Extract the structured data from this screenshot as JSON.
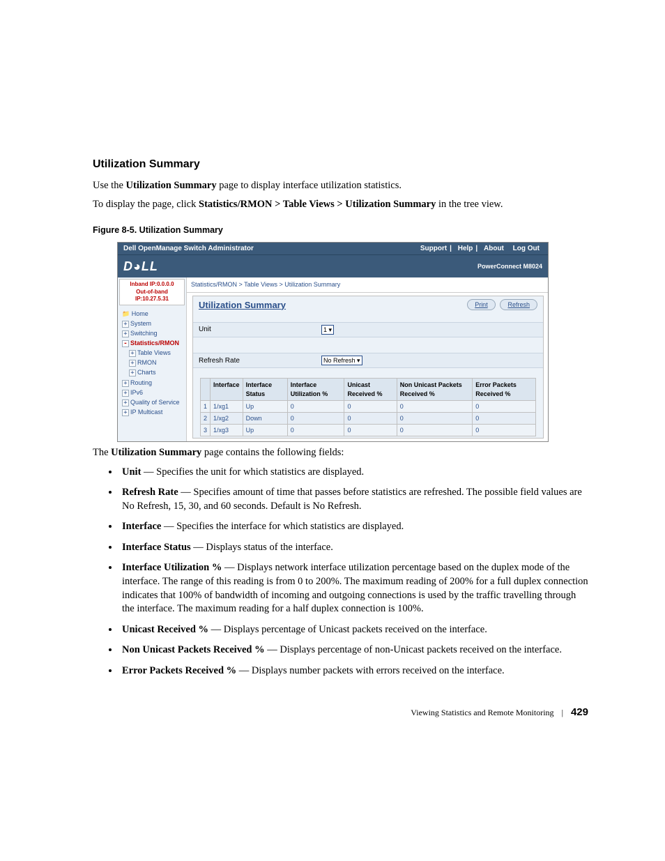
{
  "doc": {
    "heading": "Utilization Summary",
    "intro_pre": "Use the ",
    "intro_bold": "Utilization Summary",
    "intro_post": " page to display interface utilization statistics.",
    "howto_pre": "To display the page, click ",
    "howto_bold": "Statistics/RMON > Table Views > Utilization Summary",
    "howto_post": " in the tree view.",
    "fig_caption": "Figure 8-5.    Utilization Summary",
    "after_fig_pre": "The ",
    "after_fig_bold": "Utilization Summary",
    "after_fig_post": " page contains the following fields:"
  },
  "fields": {
    "f1_b": "Unit",
    "f1_t": " — Specifies the unit for which statistics are displayed.",
    "f2_b": "Refresh Rate",
    "f2_t": " — Specifies amount of time that passes before statistics are refreshed. The possible field values are No Refresh, 15, 30, and 60 seconds. Default is No Refresh.",
    "f3_b": "Interface",
    "f3_t": " — Specifies the interface for which statistics are displayed.",
    "f4_b": "Interface Status",
    "f4_t": " — Displays status of the interface.",
    "f5_b": "Interface Utilization %",
    "f5_t": " — Displays network interface utilization percentage based on the duplex mode of the interface. The range of this reading is from 0 to 200%. The maximum reading of 200% for a full duplex connection indicates that 100% of bandwidth of incoming and outgoing connections is used by the traffic travelling through the interface. The maximum reading for a half duplex connection is 100%.",
    "f6_b": "Unicast Received %",
    "f6_t": " — Displays percentage of Unicast packets received on the interface.",
    "f7_b": "Non Unicast Packets Received %",
    "f7_t": " — Displays percentage of non-Unicast packets received on the interface.",
    "f8_b": "Error Packets Received %",
    "f8_t": " — Displays number packets with errors received on the interface."
  },
  "footer": {
    "chapter": "Viewing Statistics and Remote Monitoring",
    "page": "429"
  },
  "ss": {
    "titlebar": "Dell OpenManage Switch Administrator",
    "links": {
      "support": "Support",
      "help": "Help",
      "about": "About",
      "logout": "Log Out"
    },
    "logo": "D◕LL",
    "product": "PowerConnect M8024",
    "ip": {
      "inband": "Inband IP:0.0.0.0",
      "oob": "Out-of-band IP:10.27.5.31"
    },
    "tree": {
      "home": "Home",
      "system": "System",
      "switching": "Switching",
      "stats": "Statistics/RMON",
      "tableviews": "Table Views",
      "rmon": "RMON",
      "charts": "Charts",
      "routing": "Routing",
      "ipv6": "IPv6",
      "qos": "Quality of Service",
      "ipmulti": "IP Multicast"
    },
    "breadcrumb": "Statistics/RMON > Table Views > Utilization Summary",
    "panel_title": "Utilization Summary",
    "btn_print": "Print",
    "btn_refresh": "Refresh",
    "unit_label": "Unit",
    "unit_value": "1",
    "refresh_label": "Refresh Rate",
    "refresh_value": "No Refresh",
    "cols": {
      "idx": "",
      "iface": "Interface",
      "status": "Interface Status",
      "util": "Interface Utilization %",
      "uni": "Unicast Received %",
      "nonuni": "Non Unicast Packets Received %",
      "err": "Error Packets Received %"
    },
    "rows": [
      {
        "idx": "1",
        "iface": "1/xg1",
        "status": "Up",
        "util": "0",
        "uni": "0",
        "nonuni": "0",
        "err": "0"
      },
      {
        "idx": "2",
        "iface": "1/xg2",
        "status": "Down",
        "util": "0",
        "uni": "0",
        "nonuni": "0",
        "err": "0"
      },
      {
        "idx": "3",
        "iface": "1/xg3",
        "status": "Up",
        "util": "0",
        "uni": "0",
        "nonuni": "0",
        "err": "0"
      }
    ]
  }
}
